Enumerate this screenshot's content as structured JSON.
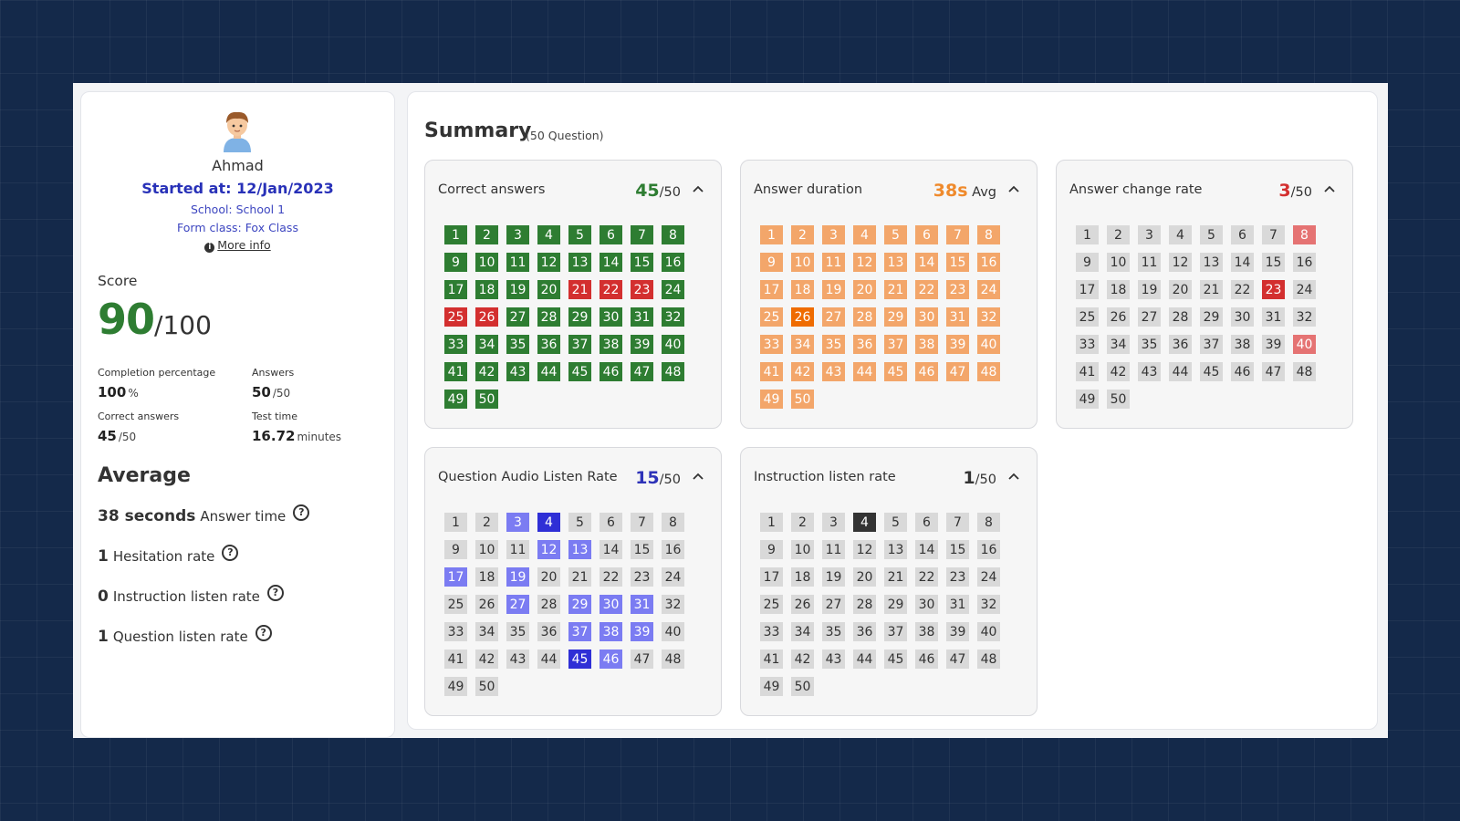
{
  "student": {
    "name": "Ahmad",
    "started": "Started at: 12/Jan/2023",
    "school": "School: School 1",
    "form_class": "Form class: Fox Class",
    "more_info": "More info"
  },
  "score": {
    "label": "Score",
    "value": "90",
    "max": "/100",
    "stats": {
      "completion": {
        "label": "Completion percentage",
        "value": "100",
        "unit": "%"
      },
      "answers": {
        "label": "Answers",
        "value": "50",
        "unit": "/50"
      },
      "correct": {
        "label": "Correct answers",
        "value": "45",
        "unit": "/50"
      },
      "test_time": {
        "label": "Test time",
        "value": "16.72",
        "unit": "minutes"
      }
    }
  },
  "average": {
    "title": "Average",
    "rows": [
      {
        "num": "38 seconds",
        "label": "Answer time"
      },
      {
        "num": "1",
        "label": "Hesitation rate"
      },
      {
        "num": "0",
        "label": "Instruction listen rate"
      },
      {
        "num": "1",
        "label": "Question listen rate"
      }
    ]
  },
  "summary": {
    "title": "Summary",
    "subtitle": "(50 Question)",
    "total_questions": 50,
    "cards": [
      {
        "title": "Correct answers",
        "value": "45",
        "value_color": "#2e7d32",
        "suffix": "/50",
        "default_color": "#2e7d32",
        "default_text": "#ffffff",
        "highlights": [
          {
            "color": "#d32f2f",
            "text": "#ffffff",
            "items": [
              21,
              22,
              23,
              25,
              26
            ]
          }
        ]
      },
      {
        "title": "Answer duration",
        "value": "38s",
        "value_color": "#ef8a2c",
        "suffix": "Avg",
        "default_color": "#f3a66a",
        "default_text": "#ffffff",
        "highlights": [
          {
            "color": "#ef6c00",
            "text": "#ffffff",
            "items": [
              26
            ]
          }
        ]
      },
      {
        "title": "Answer change rate",
        "value": "3",
        "value_color": "#d32f2f",
        "suffix": "/50",
        "default_color": "#d9d9d9",
        "default_text": "#333333",
        "highlights": [
          {
            "color": "#e57373",
            "text": "#ffffff",
            "items": [
              8,
              40
            ]
          },
          {
            "color": "#d32f2f",
            "text": "#ffffff",
            "items": [
              23
            ]
          }
        ]
      },
      {
        "title": "Question Audio Listen Rate",
        "value": "15",
        "value_color": "#2e33b8",
        "suffix": "/50",
        "default_color": "#d9d9d9",
        "default_text": "#333333",
        "highlights": [
          {
            "color": "#7b7cf2",
            "text": "#ffffff",
            "items": [
              3,
              12,
              13,
              17,
              19,
              27,
              29,
              30,
              31,
              37,
              38,
              39,
              46
            ]
          },
          {
            "color": "#2f2fd6",
            "text": "#ffffff",
            "items": [
              4,
              45
            ]
          }
        ]
      },
      {
        "title": "Instruction listen rate",
        "value": "1",
        "value_color": "#333333",
        "suffix": "/50",
        "default_color": "#d9d9d9",
        "default_text": "#333333",
        "highlights": [
          {
            "color": "#333333",
            "text": "#ffffff",
            "items": [
              4
            ]
          }
        ]
      }
    ]
  }
}
